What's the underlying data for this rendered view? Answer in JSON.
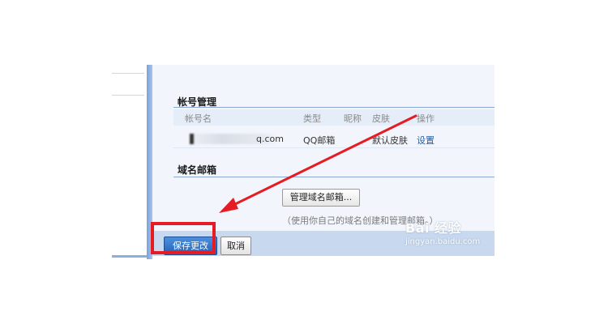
{
  "account_management": {
    "title": "帐号管理",
    "columns": [
      "帐号名",
      "类型",
      "昵称",
      "皮肤",
      "操作"
    ],
    "rows": [
      {
        "account": "q.com",
        "type": "QQ邮箱",
        "nickname": "",
        "skin": "默认皮肤",
        "action": "设置"
      }
    ]
  },
  "domain_mail": {
    "title": "域名邮箱",
    "manage_button": "管理域名邮箱...",
    "note": "（使用你自己的域名创建和管理邮箱。）"
  },
  "footer": {
    "save_label": "保存更改",
    "cancel_label": "取消"
  },
  "watermark": {
    "logo": "Bai 经验",
    "url": "jingyan.baidu.com"
  },
  "colors": {
    "highlight": "#e51c23",
    "arrow": "#e51c23",
    "accent": "#2063b8",
    "link": "#1d5fa8"
  }
}
